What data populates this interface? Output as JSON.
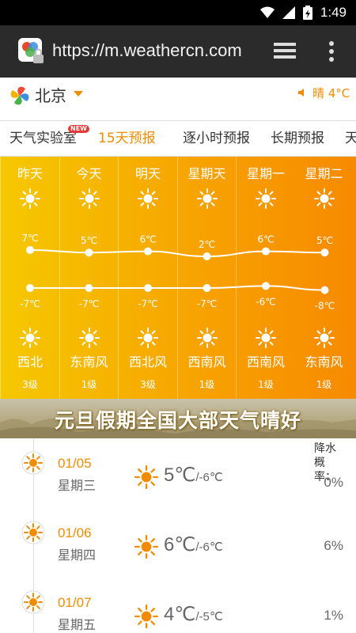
{
  "status_bar": {
    "time": "1:49"
  },
  "browser": {
    "url": "https://m.weathercn.com"
  },
  "city": {
    "name": "北京",
    "current": "晴 4°C"
  },
  "tabs": [
    {
      "label": "天气实验室",
      "badge": "NEW",
      "active": false
    },
    {
      "label": "15天预报",
      "active": true
    },
    {
      "label": "逐小时预报",
      "active": false
    },
    {
      "label": "长期预报",
      "active": false
    },
    {
      "label": "天",
      "active": false
    }
  ],
  "forecast": [
    {
      "day": "昨天",
      "high": "7℃",
      "low": "-7℃",
      "wind": "西北",
      "level": "3级"
    },
    {
      "day": "今天",
      "high": "5℃",
      "low": "-7℃",
      "wind": "东南风",
      "level": "1级"
    },
    {
      "day": "明天",
      "high": "6℃",
      "low": "-7℃",
      "wind": "西北风",
      "level": "3级"
    },
    {
      "day": "星期天",
      "high": "2℃",
      "low": "-7℃",
      "wind": "西南风",
      "level": "1级"
    },
    {
      "day": "星期一",
      "high": "6℃",
      "low": "-6℃",
      "wind": "西南风",
      "level": "1级"
    },
    {
      "day": "星期二",
      "high": "5℃",
      "low": "-8℃",
      "wind": "东南风",
      "level": "1级"
    }
  ],
  "banner": {
    "text": "元旦假期全国大部天气晴好"
  },
  "rain_label": "降水概率：",
  "daily": [
    {
      "date": "01/05",
      "weekday": "星期三",
      "high": "5℃",
      "low": "/-6℃",
      "rain": "0%"
    },
    {
      "date": "01/06",
      "weekday": "星期四",
      "high": "6℃",
      "low": "/-6℃",
      "rain": "6%"
    },
    {
      "date": "01/07",
      "weekday": "星期五",
      "high": "4℃",
      "low": "/-5℃",
      "rain": "1%"
    }
  ],
  "colors": {
    "accent": "#f08c00",
    "browser_bar": "#2b2b2b",
    "status_bar": "#000000"
  }
}
